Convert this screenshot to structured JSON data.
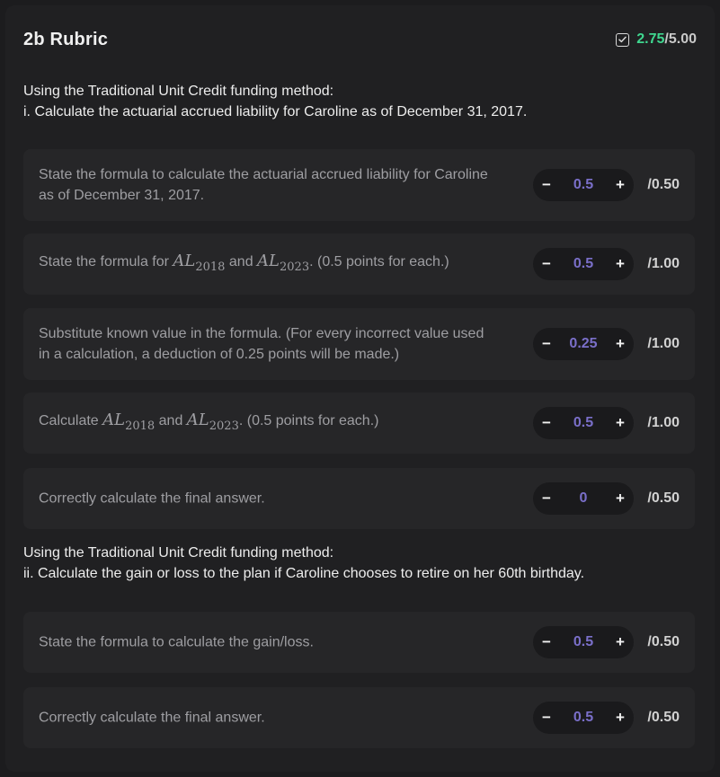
{
  "rubric": {
    "title": "2b Rubric",
    "score_earned": "2.75",
    "score_total": "/5.00"
  },
  "sections": [
    {
      "prompt_line1": "Using the Traditional Unit Credit funding method:",
      "prompt_line2": "i. Calculate the actuarial accrued liability for Caroline as of December 31, 2017.",
      "criteria": [
        {
          "text": "State the formula to calculate the actuarial accrued liability for Caroline as of December 31, 2017.",
          "value": "0.5",
          "max": "/0.50"
        },
        {
          "text_before": "State the formula for ",
          "math1_base": "AL",
          "math1_sub": "2018",
          "text_mid": " and ",
          "math2_base": "AL",
          "math2_sub": "2023",
          "text_after": ". (0.5 points for each.)",
          "value": "0.5",
          "max": "/1.00"
        },
        {
          "text": "Substitute known value in the formula. (For every incorrect value used in a calculation, a deduction of 0.25 points will be made.)",
          "value": "0.25",
          "max": "/1.00"
        },
        {
          "text_before": "Calculate ",
          "math1_base": "AL",
          "math1_sub": "2018",
          "text_mid": " and ",
          "math2_base": "AL",
          "math2_sub": "2023",
          "text_after": ". (0.5 points for each.)",
          "value": "0.5",
          "max": "/1.00"
        },
        {
          "text": "Correctly calculate the final answer.",
          "value": "0",
          "max": "/0.50"
        }
      ]
    },
    {
      "prompt_line1": "Using the Traditional Unit Credit funding method:",
      "prompt_line2": "ii. Calculate the gain or loss to the plan if Caroline chooses to retire on her 60th birthday.",
      "criteria": [
        {
          "text": "State the formula to calculate the gain/loss.",
          "value": "0.5",
          "max": "/0.50"
        },
        {
          "text": "Correctly calculate the final answer.",
          "value": "0.5",
          "max": "/0.50"
        }
      ]
    }
  ],
  "controls": {
    "minus_symbol": "−",
    "plus_symbol": "+"
  },
  "icons": {
    "score_icon": "checkbox-checked-icon"
  },
  "colors": {
    "earned": "#3fd68f",
    "value": "#7a6fc9"
  }
}
